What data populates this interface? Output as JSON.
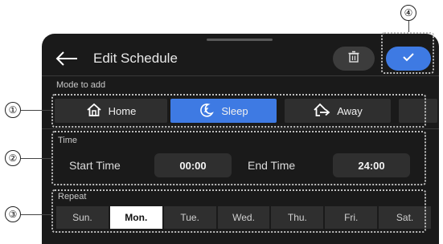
{
  "header": {
    "title": "Edit Schedule",
    "back_icon": "back-arrow-icon",
    "delete_icon": "trash-icon",
    "confirm_icon": "checkmark-icon"
  },
  "mode": {
    "label": "Mode to add",
    "options": [
      {
        "label": "Home",
        "icon": "home-icon",
        "selected": false
      },
      {
        "label": "Sleep",
        "icon": "sleep-moon-icon",
        "selected": true
      },
      {
        "label": "Away",
        "icon": "away-house-arrow-icon",
        "selected": false
      }
    ]
  },
  "time": {
    "label": "Time",
    "start_label": "Start Time",
    "start_value": "00:00",
    "end_label": "End Time",
    "end_value": "24:00"
  },
  "repeat": {
    "label": "Repeat",
    "days": [
      {
        "label": "Sun.",
        "selected": false
      },
      {
        "label": "Mon.",
        "selected": true
      },
      {
        "label": "Tue.",
        "selected": false
      },
      {
        "label": "Wed.",
        "selected": false
      },
      {
        "label": "Thu.",
        "selected": false
      },
      {
        "label": "Fri.",
        "selected": false
      },
      {
        "label": "Sat.",
        "selected": false
      }
    ]
  },
  "callouts": [
    "①",
    "②",
    "③",
    "④"
  ],
  "colors": {
    "accent": "#3e7ae3",
    "background": "#1a1a1a",
    "button": "#2f2f2f"
  }
}
